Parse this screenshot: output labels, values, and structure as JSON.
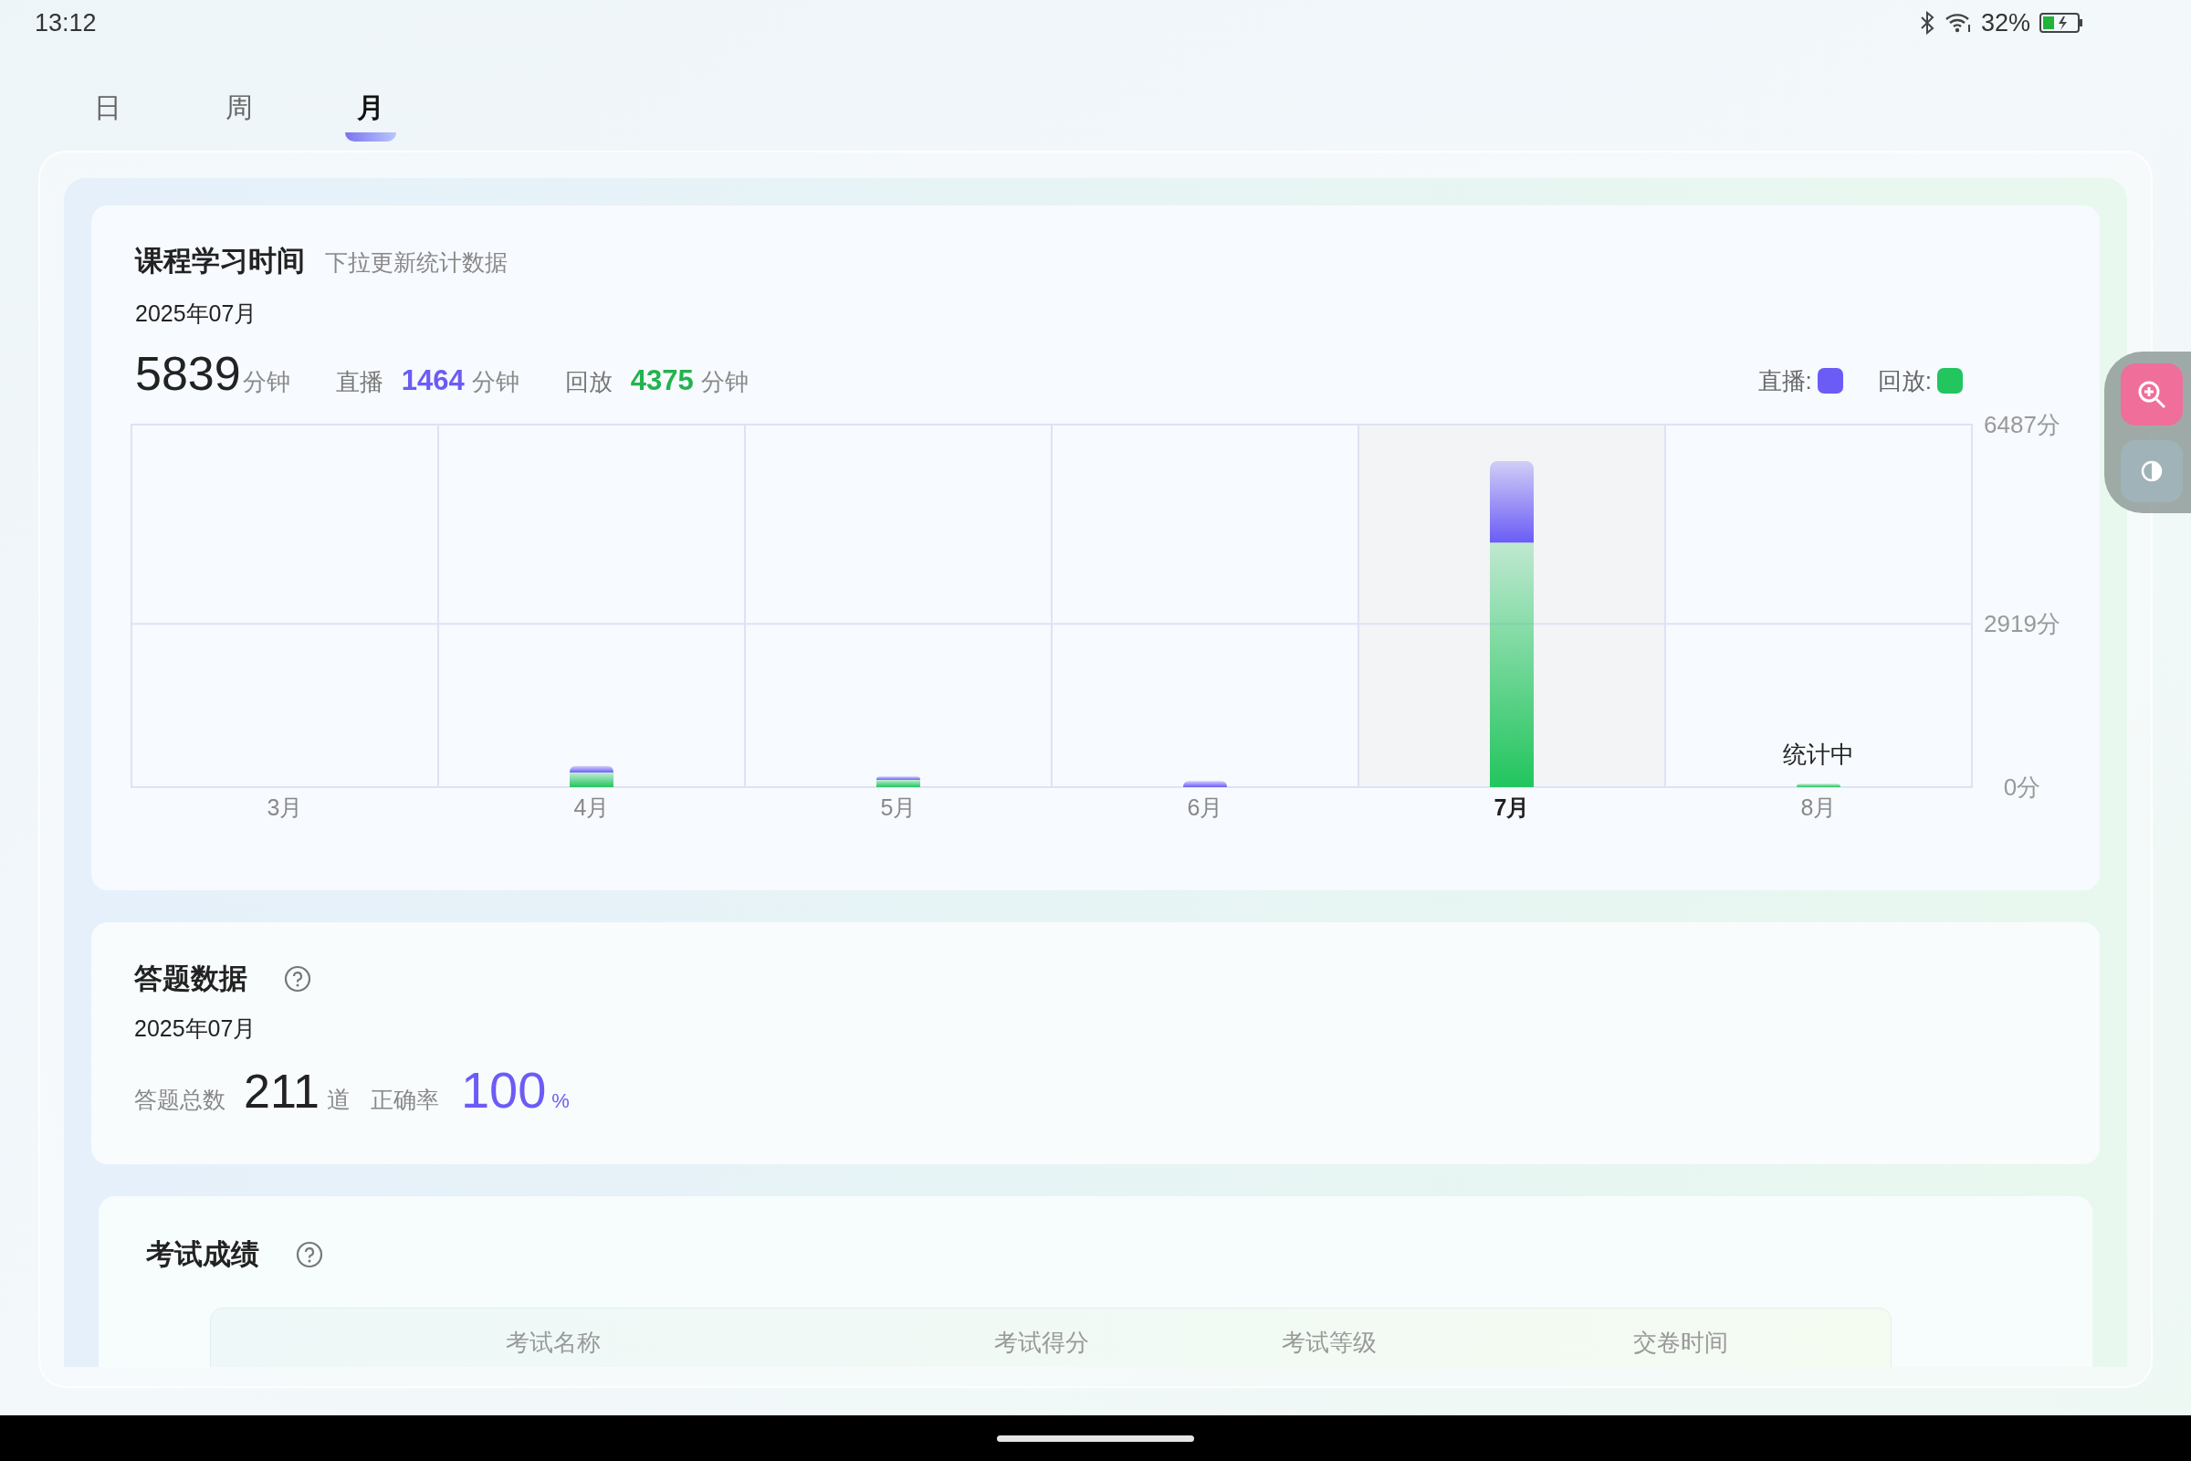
{
  "status_bar": {
    "time": "13:12",
    "battery": "32%"
  },
  "tabs": [
    {
      "label": "日",
      "selected": false
    },
    {
      "label": "周",
      "selected": false
    },
    {
      "label": "月",
      "selected": true
    }
  ],
  "study_time": {
    "title": "课程学习时间",
    "hint": "下拉更新统计数据",
    "date": "2025年07月",
    "total": "5839",
    "total_unit": "分钟",
    "live_label": "直播",
    "live_value": "1464",
    "live_unit": "分钟",
    "replay_label": "回放",
    "replay_value": "4375",
    "replay_unit": "分钟",
    "legend_suffix": ":",
    "columns": [
      {
        "selected": false
      },
      {
        "selected": false
      },
      {
        "selected": false
      },
      {
        "selected": false
      },
      {
        "selected": true
      },
      {
        "selected": false,
        "note": "统计中"
      }
    ],
    "chart_data": {
      "type": "bar",
      "stacked": true,
      "categories": [
        "3月",
        "4月",
        "5月",
        "6月",
        "7月",
        "8月"
      ],
      "series": [
        {
          "name": "回放",
          "color": "#22c55e",
          "values": [
            0,
            260,
            130,
            0,
            4375,
            60
          ]
        },
        {
          "name": "直播",
          "color": "#6b5cf6",
          "values": [
            0,
            120,
            60,
            110,
            1464,
            0
          ]
        }
      ],
      "ylim": [
        0,
        6487
      ],
      "yticks": [
        {
          "value": 0,
          "label": "0分"
        },
        {
          "value": 2919,
          "label": "2919分"
        },
        {
          "value": 6487,
          "label": "6487分"
        }
      ]
    }
  },
  "answers": {
    "title": "答题数据",
    "date": "2025年07月",
    "total_label": "答题总数",
    "total": "211",
    "total_unit": "道",
    "rate_label": "正确率",
    "rate": "100",
    "rate_unit": "%"
  },
  "exams": {
    "title": "考试成绩",
    "columns": [
      "考试名称",
      "考试得分",
      "考试等级",
      "交卷时间"
    ]
  }
}
